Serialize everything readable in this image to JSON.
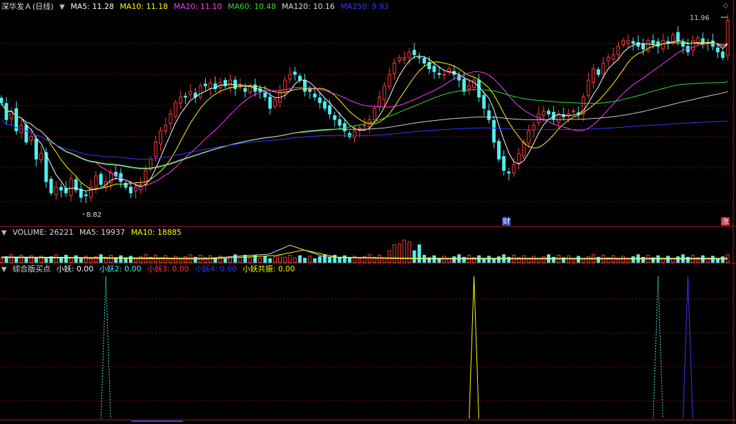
{
  "header": {
    "stock_name": "深华发Ａ",
    "period": "(日线)",
    "ma_items": [
      {
        "label": "MA5: 11.28",
        "color": "#ffffff"
      },
      {
        "label": "MA10: 11.18",
        "color": "#ffff00"
      },
      {
        "label": "MA20: 11.10",
        "color": "#ff3cff"
      },
      {
        "label": "MA60: 10.48",
        "color": "#33dd33"
      },
      {
        "label": "MA120: 10.16",
        "color": "#dddddd"
      },
      {
        "label": "MA250: 9.93",
        "color": "#3838ff"
      }
    ]
  },
  "price_panel": {
    "high_label": "11.96",
    "low_label": "8.82",
    "tag_cai": "财",
    "tag_zhang": "涨",
    "colors": {
      "up": "#ff3a3a",
      "down": "#4ef0f0",
      "grid": "#7a1010"
    }
  },
  "volume_header": {
    "label": "VOLUME: 26221",
    "ma5": "MA5: 19937",
    "ma10": "MA10: 18885"
  },
  "indicator_header": {
    "name": "综合版买点",
    "items": [
      {
        "label": "小妖: 0.00",
        "color": "#ffffff"
      },
      {
        "label": "小妖2: 0.00",
        "color": "#4ef0f0"
      },
      {
        "label": "小妖3: 0.00",
        "color": "#ff3a3a"
      },
      {
        "label": "小妖4: 0.00",
        "color": "#3838ff"
      },
      {
        "label": "小妖共振: 0.00",
        "color": "#ffff00"
      }
    ]
  },
  "chart_data": {
    "type": "candlestick",
    "x": [
      0,
      1,
      2,
      3,
      4,
      5,
      6,
      7,
      8,
      9,
      10,
      11,
      12,
      13,
      14,
      15,
      16,
      17,
      18,
      19,
      20,
      21,
      22,
      23,
      24,
      25,
      26,
      27,
      28,
      29,
      30,
      31,
      32,
      33,
      34,
      35,
      36,
      37,
      38,
      39,
      40,
      41,
      42,
      43,
      44,
      45,
      46,
      47,
      48,
      49,
      50,
      51,
      52,
      53,
      54,
      55,
      56,
      57,
      58,
      59,
      60,
      61,
      62,
      63,
      64,
      65,
      66,
      67,
      68,
      69,
      70,
      71,
      72,
      73,
      74,
      75,
      76,
      77,
      78,
      79,
      80,
      81,
      82,
      83,
      84,
      85,
      86,
      87,
      88,
      89,
      90,
      91,
      92,
      93,
      94,
      95,
      96,
      97,
      98,
      99,
      100,
      101,
      102,
      103,
      104,
      105,
      106,
      107,
      108,
      109,
      110,
      111,
      112,
      113,
      114,
      115,
      116,
      117,
      118,
      119,
      120,
      121,
      122,
      123,
      124,
      125,
      126,
      127,
      128,
      129,
      130,
      131,
      132,
      133,
      134,
      135,
      136,
      137,
      138,
      139,
      140,
      141,
      142,
      143,
      144,
      145,
      146,
      147,
      148,
      149,
      150,
      151,
      152,
      153,
      154,
      155,
      156,
      157,
      158,
      159,
      160,
      161,
      162,
      163,
      164,
      165,
      166,
      167,
      168,
      169,
      170,
      171,
      172,
      173,
      174,
      175,
      176,
      177,
      178,
      179,
      180,
      181,
      182,
      183,
      184,
      185,
      186,
      187,
      188,
      189,
      190,
      191,
      192,
      193,
      194,
      195,
      196,
      197,
      198,
      199,
      200,
      201,
      202,
      203,
      204,
      205,
      206,
      207,
      208,
      209,
      210
    ],
    "y_range": [
      8.5,
      12.1
    ],
    "close": [
      10.5,
      10.2,
      10.35,
      10.0,
      10.1,
      9.8,
      9.9,
      9.5,
      9.6,
      9.1,
      8.9,
      9.0,
      8.95,
      8.9,
      9.15,
      8.95,
      8.82,
      8.85,
      9.0,
      9.2,
      9.05,
      9.1,
      9.25,
      9.2,
      9.1,
      9.0,
      8.9,
      9.0,
      9.05,
      9.3,
      9.5,
      9.8,
      10.0,
      10.1,
      10.3,
      10.5,
      10.6,
      10.6,
      10.7,
      10.6,
      10.8,
      10.8,
      10.85,
      10.75,
      10.85,
      10.8,
      10.9,
      10.75,
      10.8,
      10.7,
      10.8,
      10.7,
      10.7,
      10.6,
      10.4,
      10.55,
      10.7,
      10.9,
      11.0,
      11.0,
      10.9,
      10.7,
      10.7,
      10.6,
      10.5,
      10.4,
      10.3,
      10.2,
      10.1,
      10.0,
      9.9,
      10.0,
      10.05,
      10.1,
      10.2,
      10.4,
      10.6,
      10.8,
      11.0,
      11.2,
      11.3,
      11.3,
      11.4,
      11.35,
      11.3,
      11.2,
      11.1,
      11.05,
      11.0,
      11.0,
      11.1,
      11.0,
      10.9,
      10.7,
      10.8,
      10.9,
      10.6,
      10.4,
      10.2,
      9.8,
      9.5,
      9.3,
      9.25,
      9.4,
      9.6,
      9.8,
      10.0,
      10.1,
      10.3,
      10.35,
      10.3,
      10.2,
      10.3,
      10.25,
      10.3,
      10.35,
      10.3,
      10.6,
      10.9,
      11.1,
      11.0,
      11.2,
      11.3,
      11.35,
      11.5,
      11.6,
      11.6,
      11.55,
      11.5,
      11.45,
      11.6,
      11.55,
      11.5,
      11.6,
      11.55,
      11.7,
      11.6,
      11.5,
      11.4,
      11.6,
      11.65,
      11.55,
      11.55,
      11.5,
      11.4,
      11.3,
      11.96
    ],
    "volume_present": true,
    "indicator_signals": [
      {
        "series": "小妖2",
        "color": "#4ef0f0",
        "style": "dashed",
        "x": 21
      },
      {
        "series": "小妖共振",
        "color": "#ffff00",
        "style": "solid",
        "x": 95
      },
      {
        "series": "小妖2",
        "color": "#4ef0f0",
        "style": "dashed",
        "x": 132
      },
      {
        "series": "小妖4",
        "color": "#3838ff",
        "style": "solid",
        "x": 138
      }
    ]
  }
}
